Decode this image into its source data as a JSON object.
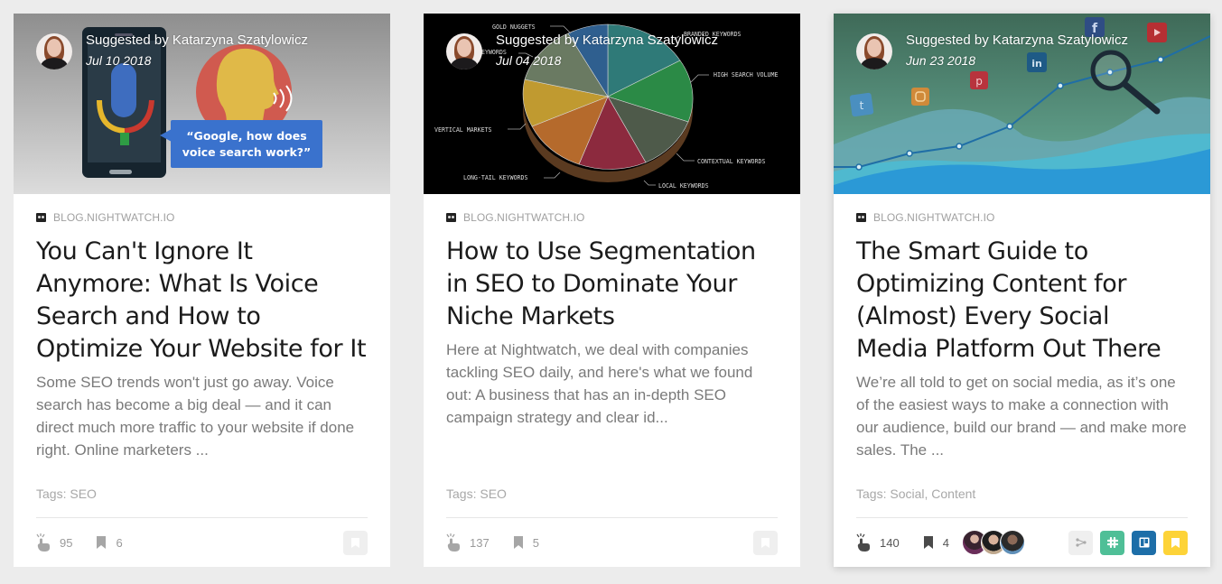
{
  "cards": [
    {
      "suggested_by": "Suggested by Katarzyna Szatylowicz",
      "date": "Jul 10 2018",
      "hero": {
        "bubble_line1": "“Google, how does",
        "bubble_line2": "voice search work?”"
      },
      "source": "BLOG.NIGHTWATCH.IO",
      "title": "You Can't Ignore It Anymore: What Is Voice Search and How to Optimize Your Website for It",
      "excerpt": "Some SEO trends won't just go away. Voice search has become a big deal — and it can direct much more traffic to your website if done right. Online marketers ...",
      "tags_label": "Tags:",
      "tags": "SEO",
      "clicks": "95",
      "bookmarks": "6"
    },
    {
      "suggested_by": "Suggested by Katarzyna Szatylowicz",
      "date": "Jul 04 2018",
      "hero": {
        "labels": [
          "GOLD NUGGETS",
          "BRANDED KEYWORDS",
          "HIGH SEARCH VOLUME",
          "CONTEXTUAL KEYWORDS",
          "LOCAL KEYWORDS",
          "LONG-TAIL KEYWORDS",
          "VERTICAL MARKETS",
          "EYWORDS"
        ]
      },
      "source": "BLOG.NIGHTWATCH.IO",
      "title": "How to Use Segmentation in SEO to Dominate Your Niche Markets",
      "excerpt": "Here at Nightwatch, we deal with companies tackling SEO daily, and here's what we found out: A business that has an in-depth SEO campaign strategy and clear id...",
      "tags_label": "Tags:",
      "tags": "SEO",
      "clicks": "137",
      "bookmarks": "5"
    },
    {
      "suggested_by": "Suggested by Katarzyna Szatylowicz",
      "date": "Jun 23 2018",
      "hero": {
        "social_icons": [
          "twitter",
          "instagram",
          "pinterest",
          "linkedin",
          "facebook",
          "youtube"
        ]
      },
      "source": "BLOG.NIGHTWATCH.IO",
      "title": "The Smart Guide to Optimizing Content for (Almost) Every Social Media Platform Out There",
      "excerpt": "We’re all told to get on social media, as it’s one of the easiest ways to make a connection with our audience, build our brand — and make more sales. The ...",
      "tags_label": "Tags:",
      "tags": "Social, Content",
      "clicks": "140",
      "bookmarks": "4",
      "shared_with_count": 3,
      "actions": [
        "share",
        "slack",
        "trello",
        "bookmark"
      ]
    }
  ],
  "colors": {
    "page_bg": "#ececec",
    "slack": "#4fbf97",
    "trello": "#1d6ea8",
    "bookmark_active": "#fdd338"
  }
}
